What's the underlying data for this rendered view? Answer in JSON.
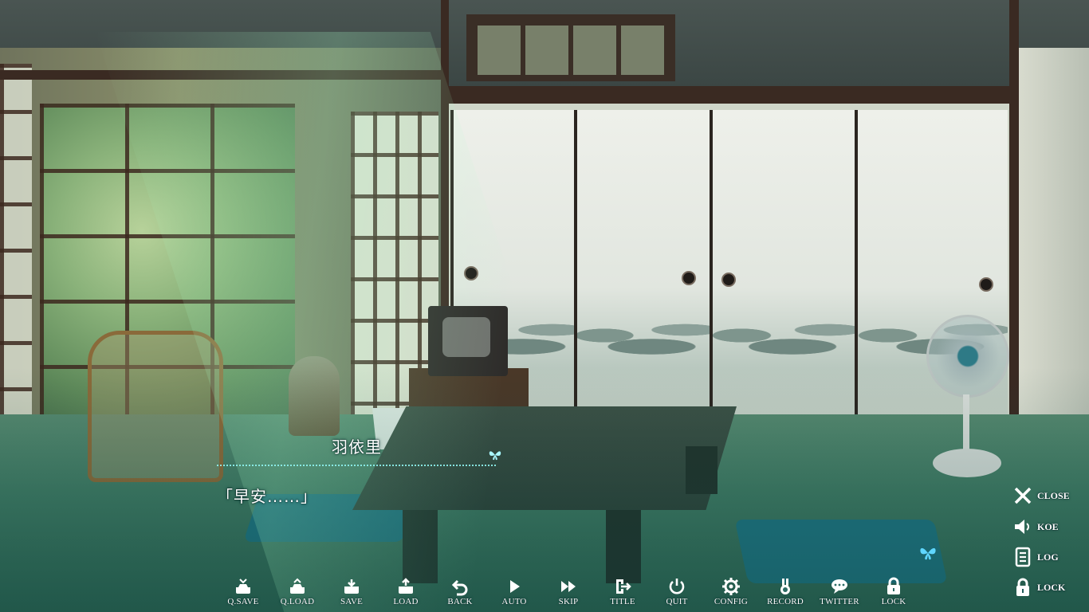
{
  "dialogue": {
    "speaker": "羽依里",
    "text": "「早安……」"
  },
  "toolbar": {
    "buttons": [
      {
        "label": "Q.SAVE",
        "icon": "quick-save-icon"
      },
      {
        "label": "Q.LOAD",
        "icon": "quick-load-icon"
      },
      {
        "label": "SAVE",
        "icon": "save-icon"
      },
      {
        "label": "LOAD",
        "icon": "load-icon"
      },
      {
        "label": "BACK",
        "icon": "back-icon"
      },
      {
        "label": "AUTO",
        "icon": "auto-play-icon"
      },
      {
        "label": "SKIP",
        "icon": "skip-icon"
      },
      {
        "label": "TITLE",
        "icon": "title-exit-icon"
      },
      {
        "label": "QUIT",
        "icon": "power-icon"
      },
      {
        "label": "CONFIG",
        "icon": "gear-icon"
      },
      {
        "label": "RECORD",
        "icon": "medal-icon"
      },
      {
        "label": "TWITTER",
        "icon": "speech-bubble-icon"
      },
      {
        "label": "LOCK",
        "icon": "lock-icon"
      }
    ]
  },
  "side_menu": {
    "close": "CLOSE",
    "koe": "KOE",
    "log": "LOG",
    "lock": "LOCK"
  },
  "colors": {
    "ui_text": "#ffffff",
    "accent_cyan": "#8ff3f0",
    "butterfly": "#5fd6ff"
  }
}
